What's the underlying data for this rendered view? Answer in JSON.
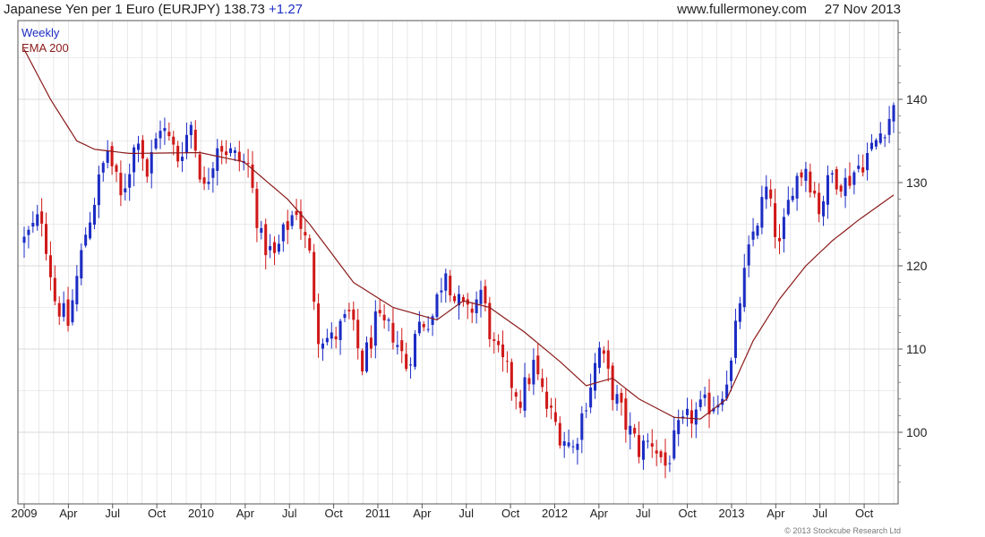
{
  "header": {
    "instrument": "Japanese Yen per 1 Euro (EURJPY)",
    "last": "138.73",
    "change": "+1.27",
    "site": "www.fullermoney.com",
    "date": "27 Nov 2013"
  },
  "footer": {
    "copyright": "© 2013 Stockcube Research Ltd"
  },
  "colors": {
    "up": "#1c2cc4",
    "down": "#d01818",
    "ema": "#8b1a1a",
    "grid": "#d9d9d9"
  },
  "chart_data": {
    "type": "candlestick",
    "legend": [
      "Weekly",
      "EMA 200"
    ],
    "y_ticks": [
      100,
      110,
      120,
      130,
      140
    ],
    "ylim": [
      92,
      150
    ],
    "x_tick_labels": [
      "2009",
      "Apr",
      "Jul",
      "Oct",
      "2010",
      "Apr",
      "Jul",
      "Oct",
      "2011",
      "Apr",
      "Jul",
      "Oct",
      "2012",
      "Apr",
      "Jul",
      "Oct",
      "2013",
      "Apr",
      "Jul",
      "Oct"
    ],
    "weekly_close_anchors": [
      {
        "week": 0,
        "close": 123
      },
      {
        "week": 4,
        "close": 126
      },
      {
        "week": 7,
        "close": 116
      },
      {
        "week": 10,
        "close": 113
      },
      {
        "week": 14,
        "close": 124
      },
      {
        "week": 19,
        "close": 134
      },
      {
        "week": 22,
        "close": 128
      },
      {
        "week": 26,
        "close": 136
      },
      {
        "week": 28,
        "close": 131
      },
      {
        "week": 31,
        "close": 137
      },
      {
        "week": 35,
        "close": 133
      },
      {
        "week": 38,
        "close": 137
      },
      {
        "week": 41,
        "close": 129
      },
      {
        "week": 44,
        "close": 135
      },
      {
        "week": 48,
        "close": 133
      },
      {
        "week": 51,
        "close": 132
      },
      {
        "week": 54,
        "close": 123
      },
      {
        "week": 57,
        "close": 121
      },
      {
        "week": 60,
        "close": 125
      },
      {
        "week": 62,
        "close": 127
      },
      {
        "week": 65,
        "close": 121
      },
      {
        "week": 67,
        "close": 112
      },
      {
        "week": 70,
        "close": 111
      },
      {
        "week": 74,
        "close": 114
      },
      {
        "week": 77,
        "close": 108
      },
      {
        "week": 80,
        "close": 113
      },
      {
        "week": 84,
        "close": 112
      },
      {
        "week": 87,
        "close": 108
      },
      {
        "week": 90,
        "close": 113
      },
      {
        "week": 93,
        "close": 114
      },
      {
        "week": 96,
        "close": 120
      },
      {
        "week": 98,
        "close": 116
      },
      {
        "week": 101,
        "close": 114
      },
      {
        "week": 104,
        "close": 117
      },
      {
        "week": 107,
        "close": 110
      },
      {
        "week": 110,
        "close": 107
      },
      {
        "week": 113,
        "close": 104
      },
      {
        "week": 116,
        "close": 108
      },
      {
        "week": 119,
        "close": 103
      },
      {
        "week": 122,
        "close": 100
      },
      {
        "week": 125,
        "close": 98
      },
      {
        "week": 128,
        "close": 104
      },
      {
        "week": 131,
        "close": 110
      },
      {
        "week": 134,
        "close": 105
      },
      {
        "week": 137,
        "close": 101
      },
      {
        "week": 140,
        "close": 98
      },
      {
        "week": 143,
        "close": 99
      },
      {
        "week": 146,
        "close": 96
      },
      {
        "week": 149,
        "close": 100
      },
      {
        "week": 152,
        "close": 102
      },
      {
        "week": 155,
        "close": 103
      },
      {
        "week": 158,
        "close": 104
      },
      {
        "week": 161,
        "close": 108
      },
      {
        "week": 163,
        "close": 116
      },
      {
        "week": 166,
        "close": 124
      },
      {
        "week": 169,
        "close": 129
      },
      {
        "week": 172,
        "close": 122
      },
      {
        "week": 175,
        "close": 130
      },
      {
        "week": 178,
        "close": 132
      },
      {
        "week": 181,
        "close": 127
      },
      {
        "week": 184,
        "close": 131
      },
      {
        "week": 187,
        "close": 130
      },
      {
        "week": 190,
        "close": 132
      },
      {
        "week": 193,
        "close": 134
      },
      {
        "week": 196,
        "close": 137
      },
      {
        "week": 198,
        "close": 138.73
      }
    ],
    "ema_anchors": [
      {
        "week": 0,
        "value": 146
      },
      {
        "week": 6,
        "value": 140
      },
      {
        "week": 12,
        "value": 135
      },
      {
        "week": 16,
        "value": 134
      },
      {
        "week": 24,
        "value": 133.5
      },
      {
        "week": 40,
        "value": 133.6
      },
      {
        "week": 50,
        "value": 132.5
      },
      {
        "week": 60,
        "value": 128
      },
      {
        "week": 65,
        "value": 125
      },
      {
        "week": 75,
        "value": 118
      },
      {
        "week": 84,
        "value": 115
      },
      {
        "week": 94,
        "value": 113.5
      },
      {
        "week": 100,
        "value": 115.8
      },
      {
        "week": 106,
        "value": 115
      },
      {
        "week": 114,
        "value": 112
      },
      {
        "week": 122,
        "value": 108.5
      },
      {
        "week": 128,
        "value": 105.6
      },
      {
        "week": 134,
        "value": 106.5
      },
      {
        "week": 140,
        "value": 104
      },
      {
        "week": 148,
        "value": 101.8
      },
      {
        "week": 154,
        "value": 101.6
      },
      {
        "week": 160,
        "value": 104
      },
      {
        "week": 166,
        "value": 111
      },
      {
        "week": 172,
        "value": 116
      },
      {
        "week": 178,
        "value": 120
      },
      {
        "week": 184,
        "value": 123
      },
      {
        "week": 190,
        "value": 125.5
      },
      {
        "week": 198,
        "value": 128.5
      }
    ]
  }
}
